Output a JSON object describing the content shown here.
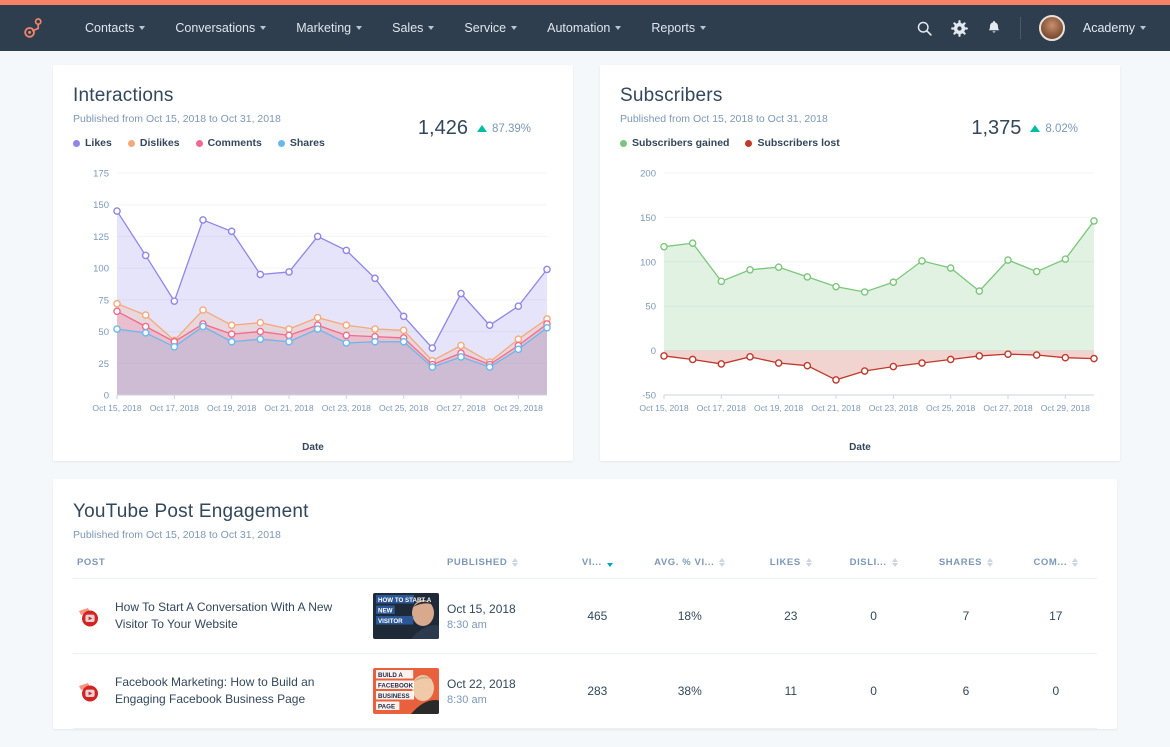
{
  "nav": {
    "logo_icon": "hubspot-sprocket-icon",
    "items": [
      {
        "label": "Contacts"
      },
      {
        "label": "Conversations"
      },
      {
        "label": "Marketing"
      },
      {
        "label": "Sales"
      },
      {
        "label": "Service"
      },
      {
        "label": "Automation"
      },
      {
        "label": "Reports"
      }
    ],
    "search_icon": "search-icon",
    "settings_icon": "gear-icon",
    "notifications_icon": "bell-icon",
    "account_label": "Academy",
    "avatar_icon": "user-avatar"
  },
  "colors": {
    "accent_bar": "#f5836a",
    "navbar": "#2e3e4e",
    "page_bg": "#f5f8fa",
    "text_primary": "#33475b",
    "text_muted": "#7c98b6",
    "positive": "#00bda5",
    "likes": "#8e86e8",
    "dislikes": "#f5a97a",
    "comments": "#ef6b8e",
    "shares": "#68b8f0",
    "subscribers_gained": "#7bc67b",
    "subscribers_lost": "#c0392b"
  },
  "cards": {
    "interactions": {
      "title": "Interactions",
      "subtitle": "Published from Oct 15, 2018 to Oct 31, 2018",
      "metric_value": "1,426",
      "metric_delta": "87.39%",
      "metric_direction": "up"
    },
    "subscribers": {
      "title": "Subscribers",
      "subtitle": "Published from Oct 15, 2018 to Oct 31, 2018",
      "metric_value": "1,375",
      "metric_delta": "8.02%",
      "metric_direction": "up"
    },
    "engagement": {
      "title": "YouTube Post Engagement",
      "subtitle": "Published from Oct 15, 2018 to Oct 31, 2018"
    }
  },
  "chart_data": [
    {
      "type": "area",
      "title": "Interactions",
      "xlabel": "Date",
      "ylabel": "",
      "ylim": [
        0,
        175
      ],
      "yticks": [
        0,
        25,
        50,
        75,
        100,
        125,
        150,
        175
      ],
      "grid": true,
      "legend_position": "top-left",
      "x": [
        "Oct 15, 2018",
        "Oct 16, 2018",
        "Oct 17, 2018",
        "Oct 18, 2018",
        "Oct 19, 2018",
        "Oct 20, 2018",
        "Oct 21, 2018",
        "Oct 22, 2018",
        "Oct 23, 2018",
        "Oct 24, 2018",
        "Oct 25, 2018",
        "Oct 26, 2018",
        "Oct 27, 2018",
        "Oct 28, 2018",
        "Oct 29, 2018",
        "Oct 30, 2018"
      ],
      "xticks": [
        "Oct 15, 2018",
        "Oct 17, 2018",
        "Oct 19, 2018",
        "Oct 21, 2018",
        "Oct 23, 2018",
        "Oct 25, 2018",
        "Oct 27, 2018",
        "Oct 29, 2018"
      ],
      "series": [
        {
          "name": "Likes",
          "color": "#8e86e8",
          "values": [
            145,
            110,
            74,
            138,
            129,
            95,
            97,
            125,
            114,
            92,
            62,
            37,
            80,
            55,
            70,
            99
          ]
        },
        {
          "name": "Dislikes",
          "color": "#f5a97a",
          "values": [
            72,
            63,
            43,
            67,
            55,
            57,
            52,
            61,
            55,
            52,
            51,
            27,
            39,
            26,
            44,
            60
          ]
        },
        {
          "name": "Comments",
          "color": "#ef6b8e",
          "values": [
            66,
            54,
            42,
            56,
            48,
            50,
            47,
            55,
            47,
            46,
            45,
            24,
            33,
            24,
            39,
            56
          ]
        },
        {
          "name": "Shares",
          "color": "#68b8f0",
          "values": [
            52,
            49,
            38,
            54,
            42,
            44,
            42,
            52,
            41,
            42,
            42,
            22,
            30,
            22,
            36,
            53
          ]
        }
      ]
    },
    {
      "type": "area",
      "title": "Subscribers",
      "xlabel": "Date",
      "ylabel": "",
      "ylim": [
        -50,
        200
      ],
      "yticks": [
        -50,
        0,
        50,
        100,
        150,
        200
      ],
      "grid": true,
      "legend_position": "top-left",
      "x": [
        "Oct 15, 2018",
        "Oct 16, 2018",
        "Oct 17, 2018",
        "Oct 18, 2018",
        "Oct 19, 2018",
        "Oct 20, 2018",
        "Oct 21, 2018",
        "Oct 22, 2018",
        "Oct 23, 2018",
        "Oct 24, 2018",
        "Oct 25, 2018",
        "Oct 26, 2018",
        "Oct 27, 2018",
        "Oct 28, 2018",
        "Oct 29, 2018",
        "Oct 30, 2018"
      ],
      "xticks": [
        "Oct 15, 2018",
        "Oct 17, 2018",
        "Oct 19, 2018",
        "Oct 21, 2018",
        "Oct 23, 2018",
        "Oct 25, 2018",
        "Oct 27, 2018",
        "Oct 29, 2018"
      ],
      "series": [
        {
          "name": "Subscribers gained",
          "color": "#7bc67b",
          "values": [
            117,
            121,
            78,
            91,
            94,
            83,
            72,
            66,
            77,
            101,
            93,
            67,
            102,
            89,
            103,
            146
          ]
        },
        {
          "name": "Subscribers lost",
          "color": "#c0392b",
          "values": [
            -6,
            -10,
            -15,
            -7,
            -14,
            -17,
            -33,
            -23,
            -18,
            -14,
            -10,
            -6,
            -4,
            -5,
            -8,
            -9
          ]
        }
      ]
    }
  ],
  "table": {
    "columns": [
      {
        "label": "POST",
        "align": "left",
        "sortable": false,
        "sorted": false
      },
      {
        "label": "PUBLISHED",
        "align": "left",
        "sortable": true,
        "sorted": false
      },
      {
        "label": "VI...",
        "align": "center",
        "sortable": true,
        "sorted": true
      },
      {
        "label": "AVG. % VI...",
        "align": "center",
        "sortable": true,
        "sorted": false
      },
      {
        "label": "LIKES",
        "align": "center",
        "sortable": true,
        "sorted": false
      },
      {
        "label": "DISLI...",
        "align": "center",
        "sortable": true,
        "sorted": false
      },
      {
        "label": "SHARES",
        "align": "center",
        "sortable": true,
        "sorted": false
      },
      {
        "label": "COM...",
        "align": "center",
        "sortable": true,
        "sorted": false
      }
    ],
    "rows": [
      {
        "icon": "youtube-play-icon",
        "title": "How To Start A Conversation With A New Visitor To Your Website",
        "thumbnail_text_1": "HOW TO START A",
        "thumbnail_text_2": "NEW",
        "thumbnail_text_3": "VISITOR",
        "published_date": "Oct 15, 2018",
        "published_time": "8:30 am",
        "views": "465",
        "avg_pct_viewed": "18%",
        "likes": "23",
        "dislikes": "0",
        "shares": "7",
        "comments": "17"
      },
      {
        "icon": "youtube-play-icon",
        "title": "Facebook Marketing: How to Build an Engaging Facebook Business Page",
        "thumbnail_text_1": "BUILD A",
        "thumbnail_text_2": "FACEBOOK",
        "thumbnail_text_3": "BUSINESS",
        "thumbnail_text_4": "PAGE",
        "published_date": "Oct 22, 2018",
        "published_time": "8:30 am",
        "views": "283",
        "avg_pct_viewed": "38%",
        "likes": "11",
        "dislikes": "0",
        "shares": "6",
        "comments": "0"
      }
    ]
  }
}
